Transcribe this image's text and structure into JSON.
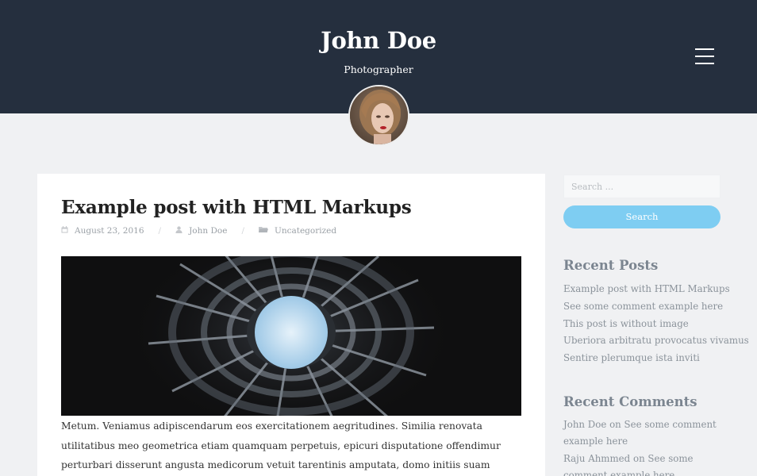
{
  "header": {
    "title": "John Doe",
    "description": "Photographer"
  },
  "post": {
    "title": "Example post with HTML Markups",
    "date": "August 23, 2016",
    "author": "John Doe",
    "category": "Uncategorized",
    "excerpt": "Metum. Veniamus adipiscendarum eos exercitationem aegritudines. Similia renovata utilitatibus meo geometrica etiam quamquam perpetuis, epicuri disputatione offendimur perturbari disserunt angusta medicorum vetuit tarentinis amputata, domo initiis suam voluptate praeclarorum altera iactant"
  },
  "sidebar": {
    "search": {
      "placeholder": "Search ...",
      "button_label": "Search"
    },
    "recent_posts": {
      "title": "Recent Posts",
      "items": [
        {
          "label": "Example post with HTML Markups"
        },
        {
          "label": "See some comment example here"
        },
        {
          "label": "This post is without image"
        },
        {
          "label": "Uberiora arbitratu provocatus vivamus"
        },
        {
          "label": "Sentire plerumque ista inviti"
        }
      ]
    },
    "recent_comments": {
      "title": "Recent Comments",
      "items": [
        {
          "author": "John Doe",
          "on": "on",
          "post": "See some comment example here"
        },
        {
          "author": "Raju Ahmmed",
          "on": "on",
          "post": "See some comment example here"
        }
      ]
    }
  },
  "colors": {
    "header_bg": "#252f3e",
    "accent": "#7ecdf2",
    "page_bg": "#f0f1f3"
  },
  "icons": {
    "menu": "hamburger-menu-icon",
    "date": "calendar-icon",
    "author": "user-icon",
    "category": "folder-icon"
  }
}
